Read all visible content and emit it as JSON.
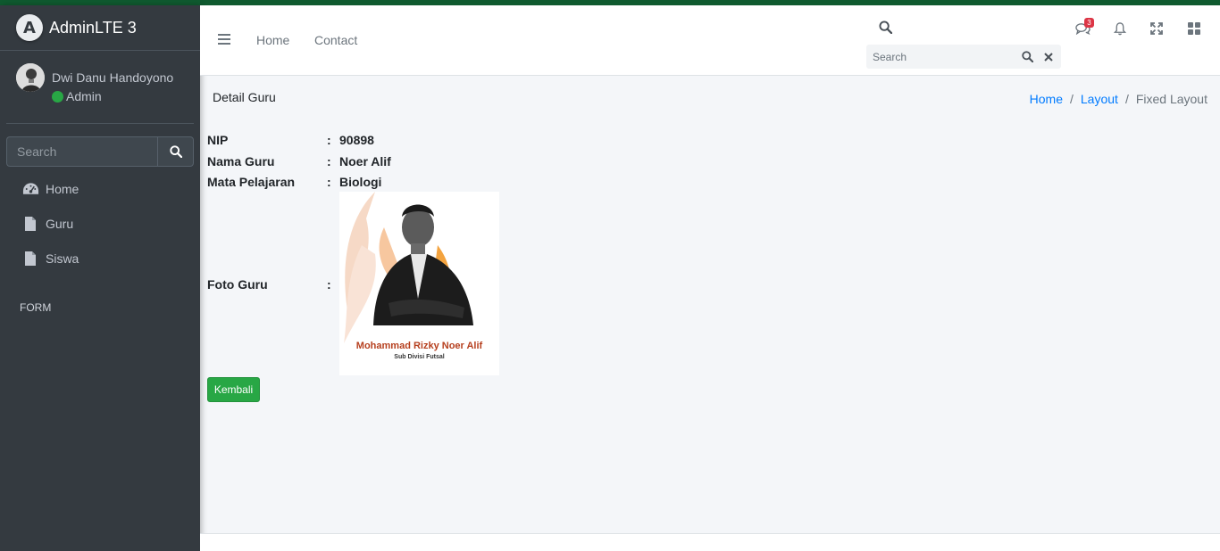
{
  "brand": {
    "title": "AdminLTE 3",
    "logo_letter": "A"
  },
  "user": {
    "name": "Dwi Danu Handoyono",
    "role": "Admin",
    "status_color": "#28a745"
  },
  "sidebar": {
    "search_placeholder": "Search",
    "items": [
      {
        "label": "Home",
        "icon": "dashboard-icon"
      },
      {
        "label": "Guru",
        "icon": "file-icon"
      },
      {
        "label": "Siswa",
        "icon": "file-icon"
      }
    ],
    "header": "FORM"
  },
  "navbar": {
    "links": [
      "Home",
      "Contact"
    ],
    "search_placeholder": "Search",
    "messages_badge": "3"
  },
  "page": {
    "title": "Detail Guru",
    "breadcrumb": [
      "Home",
      "Layout",
      "Fixed Layout"
    ]
  },
  "detail": {
    "fields": [
      {
        "label": "NIP",
        "value": "90898"
      },
      {
        "label": "Nama Guru",
        "value": "Noer Alif"
      },
      {
        "label": "Mata Pelajaran",
        "value": "Biologi"
      }
    ],
    "photo_label": "Foto Guru",
    "colon": ":",
    "photo_caption_name": "Mohammad Rizky Noer Alif",
    "photo_caption_sub": "Sub Divisi Futsal",
    "back_button": "Kembali"
  },
  "colors": {
    "accent": "#0f5a2f",
    "sidebar_bg": "#343a40",
    "link": "#007bff",
    "success": "#28a745"
  }
}
